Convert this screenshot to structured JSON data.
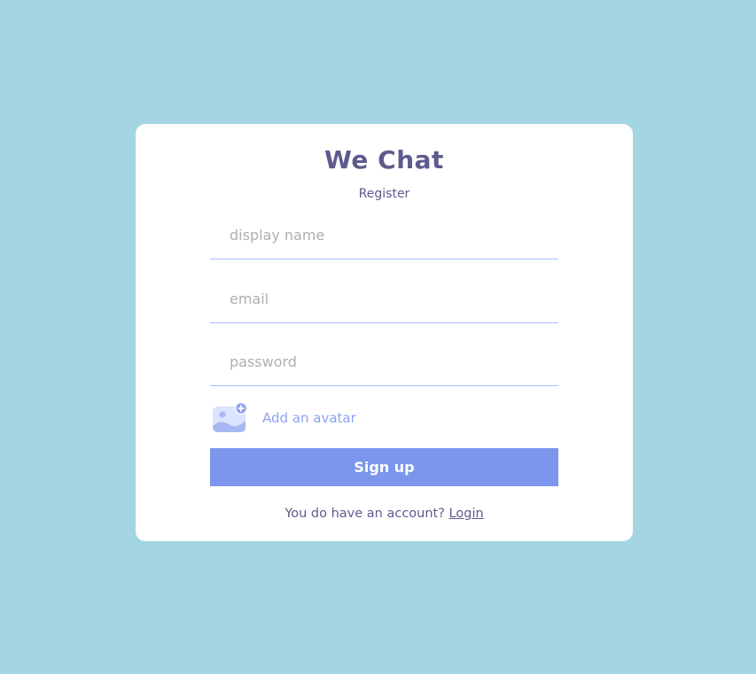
{
  "app": {
    "logo": "We Chat",
    "subtitle": "Register"
  },
  "form": {
    "display_name": {
      "placeholder": "display name",
      "value": ""
    },
    "email": {
      "placeholder": "email",
      "value": ""
    },
    "password": {
      "placeholder": "password",
      "value": ""
    },
    "avatar": {
      "label": "Add an avatar",
      "icon": "add-image-icon"
    },
    "submit_label": "Sign up"
  },
  "footer": {
    "text": "You do have an account? ",
    "link_label": "Login"
  },
  "colors": {
    "background": "#a3d6e2",
    "card": "#ffffff",
    "brand": "#5d5b8d",
    "accent": "#7b96ec",
    "field_border": "#a7bcff"
  }
}
